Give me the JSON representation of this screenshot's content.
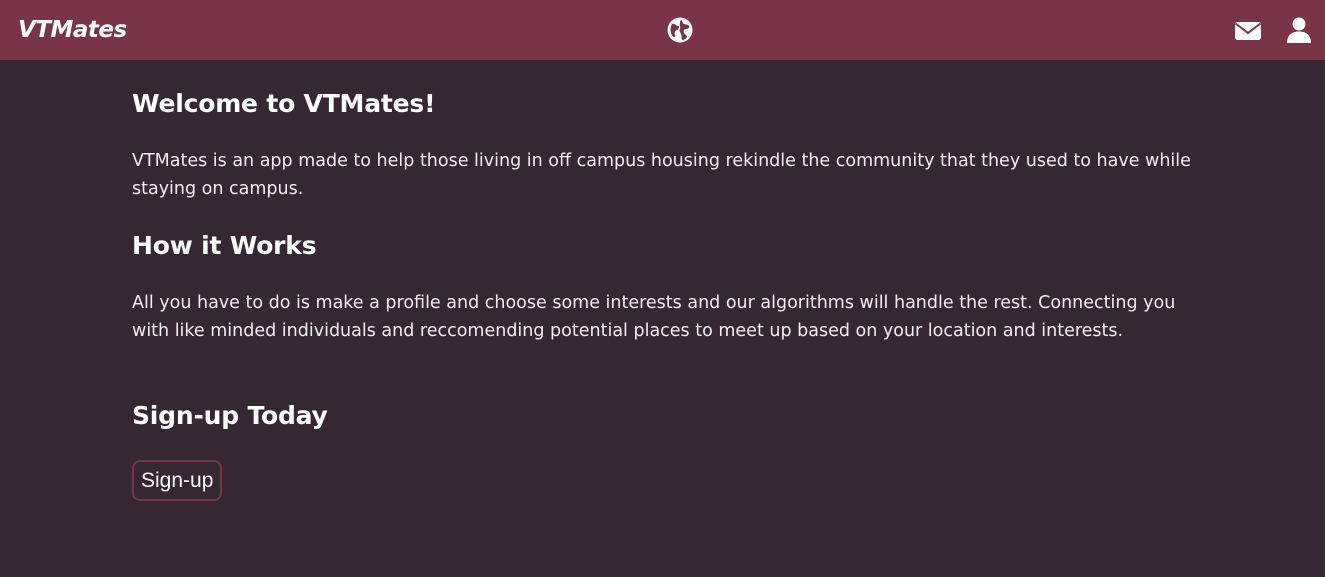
{
  "nav": {
    "brand": "VTMates",
    "icons": {
      "globe": "globe-icon",
      "mail": "envelope-icon",
      "user": "user-icon"
    },
    "color": "#7a3447"
  },
  "main": {
    "welcome_title": "Welcome to VTMates!",
    "welcome_text": "VTMates is an app made to help those living in off campus housing rekindle the community that they used to have while staying on campus.",
    "how_title": "How it Works",
    "how_text": "All you have to do is make a profile and choose some interests and our algorithms will handle the rest. Connecting you with like minded individuals and reccomending potential places to meet up based on your location and interests.",
    "signup_title": "Sign-up Today",
    "signup_button": "Sign-up"
  },
  "colors": {
    "background": "#352833",
    "accent": "#7a3447",
    "text": "#f3eef2"
  }
}
